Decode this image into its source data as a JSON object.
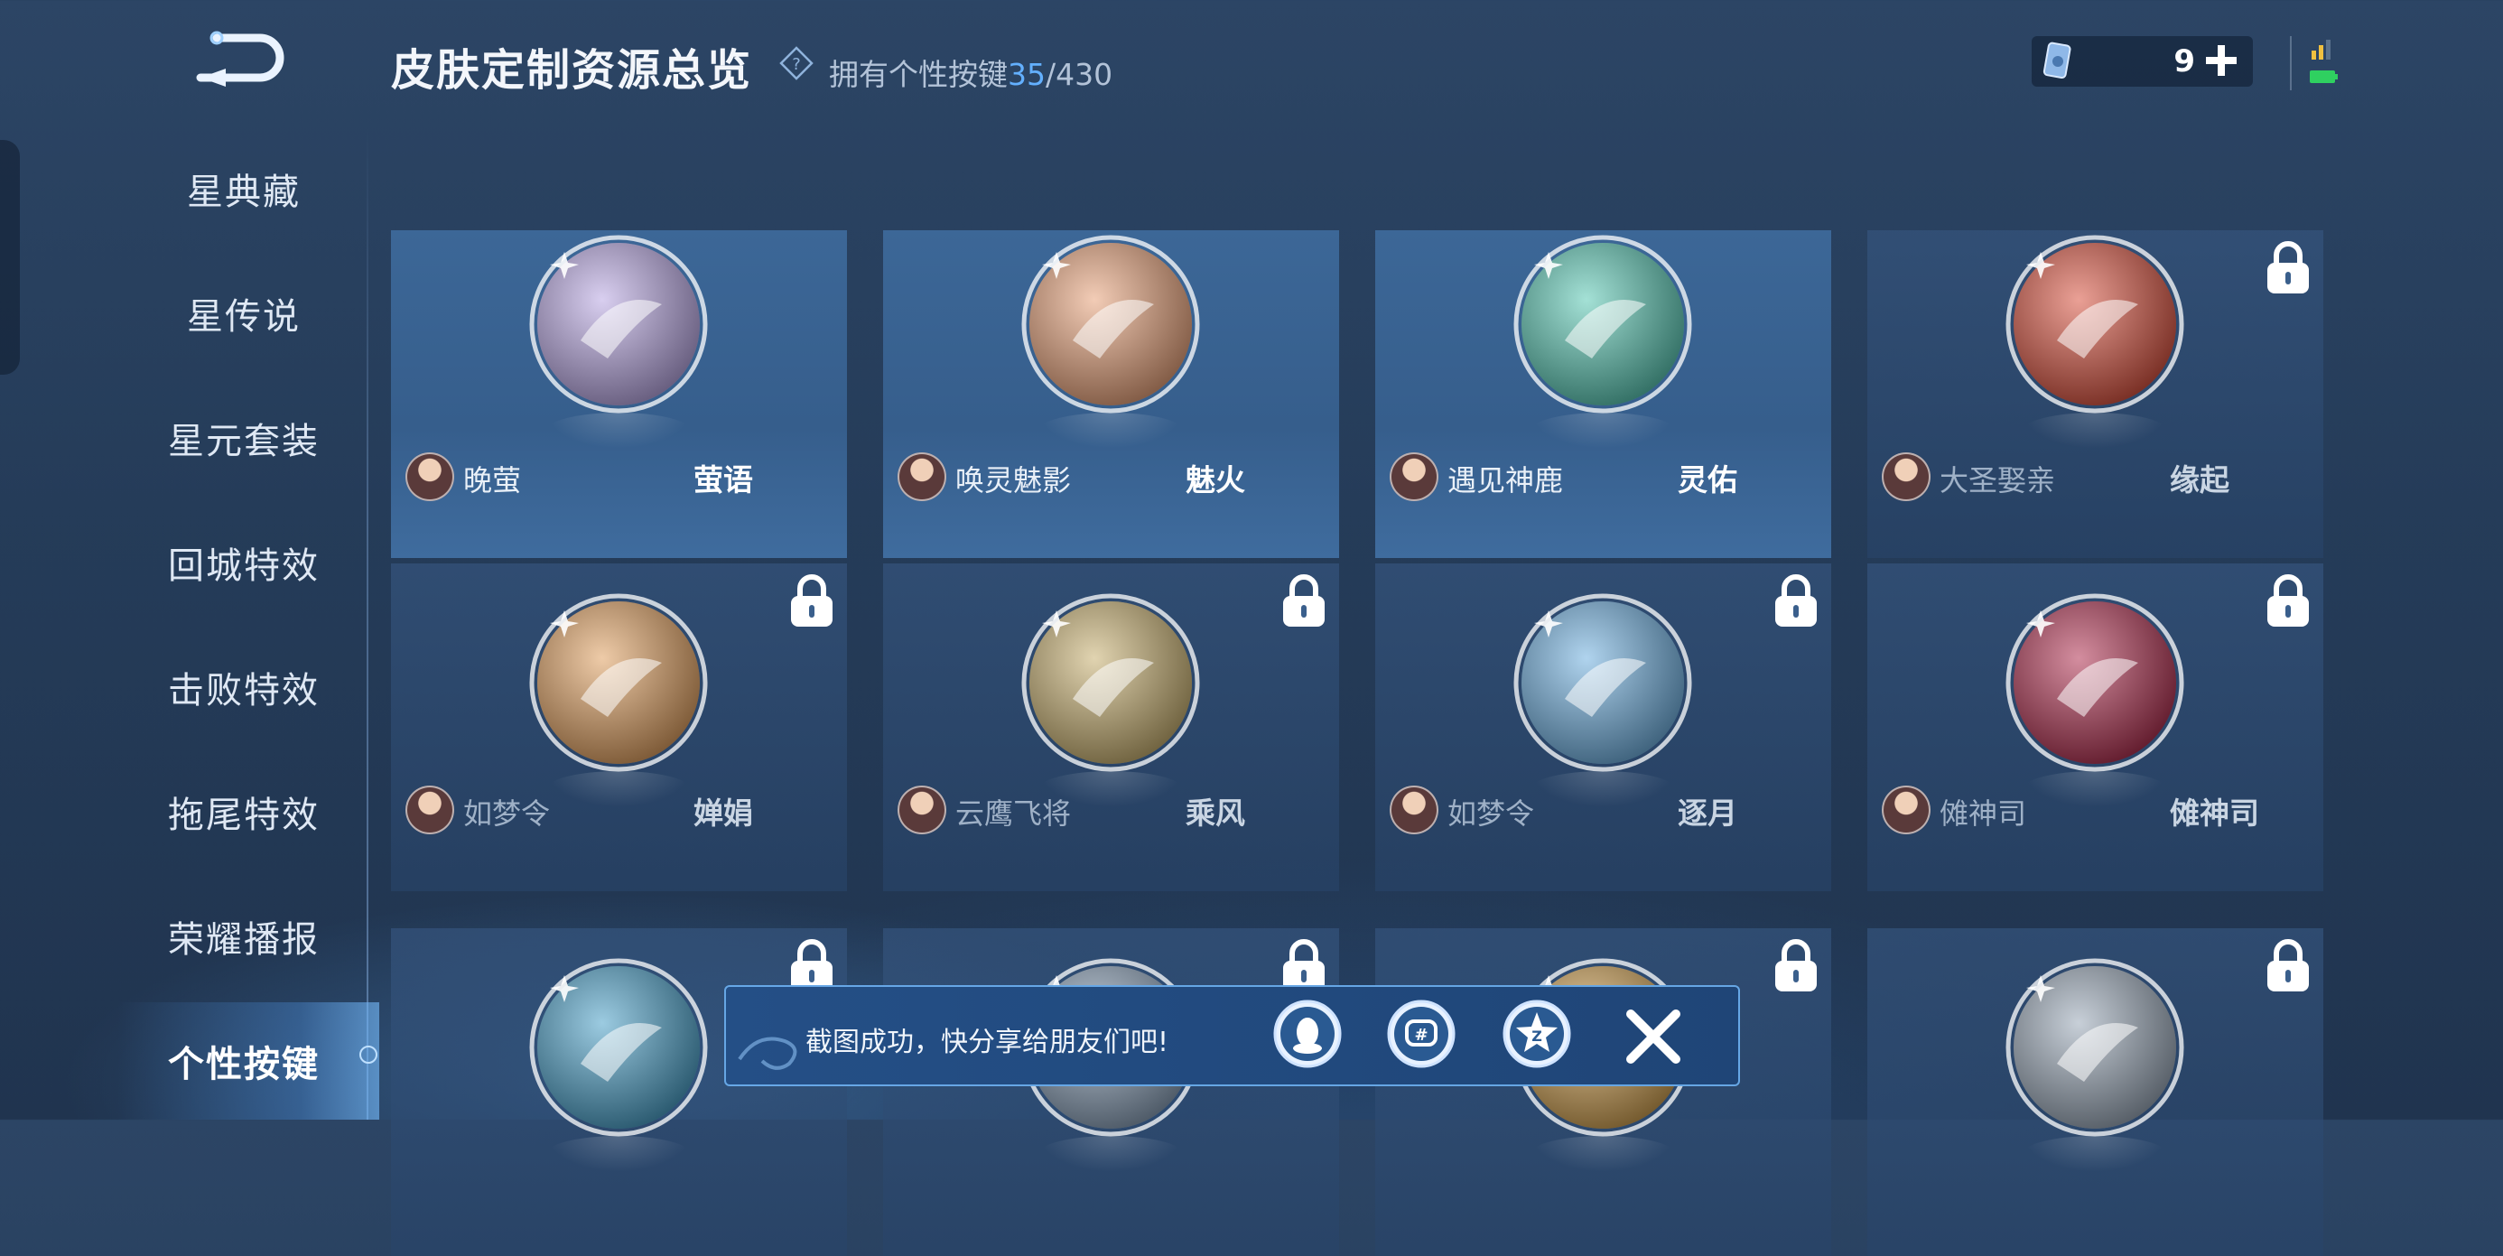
{
  "header": {
    "title": "皮肤定制资源总览",
    "owned_label": "拥有个性按键",
    "owned_count": "35",
    "owned_total": "/430"
  },
  "currency": {
    "amount": "9"
  },
  "sidebar": {
    "items": [
      {
        "label": "星典藏"
      },
      {
        "label": "星传说"
      },
      {
        "label": "星元套装"
      },
      {
        "label": "回城特效"
      },
      {
        "label": "击败特效"
      },
      {
        "label": "拖尾特效"
      },
      {
        "label": "荣耀播报"
      },
      {
        "label": "个性按键"
      }
    ],
    "active_item": "个性按键"
  },
  "cards": [
    {
      "skin": "晚萤",
      "effect": "萤语",
      "locked": false,
      "emblem_color": "#b9a7e3"
    },
    {
      "skin": "唤灵魅影",
      "effect": "魅火",
      "locked": false,
      "emblem_color": "#e8a27a"
    },
    {
      "skin": "遇见神鹿",
      "effect": "灵佑",
      "locked": false,
      "emblem_color": "#59c8b4"
    },
    {
      "skin": "大圣娶亲",
      "effect": "缘起",
      "locked": true,
      "emblem_color": "#d9523f"
    },
    {
      "skin": "如梦令",
      "effect": "婵娟",
      "locked": true,
      "emblem_color": "#e0a060"
    },
    {
      "skin": "云鹰飞将",
      "effect": "乘风",
      "locked": true,
      "emblem_color": "#c8b070"
    },
    {
      "skin": "如梦令",
      "effect": "逐月",
      "locked": true,
      "emblem_color": "#6fb0e0"
    },
    {
      "skin": "傩神司",
      "effect": "傩神司",
      "locked": true,
      "emblem_color": "#b03050"
    },
    {
      "skin": "",
      "effect": "",
      "locked": true,
      "emblem_color": "#4aa0c8"
    },
    {
      "skin": "",
      "effect": "",
      "locked": true,
      "emblem_color": "#8aa0b8"
    },
    {
      "skin": "",
      "effect": "",
      "locked": true,
      "emblem_color": "#d0a050"
    },
    {
      "skin": "",
      "effect": "",
      "locked": true,
      "emblem_color": "#9aa8b8"
    }
  ],
  "toast": {
    "message": "截图成功，快分享给朋友们吧!"
  },
  "colors": {
    "accent": "#63b0ff",
    "background": "#253c59",
    "owned_card": "#3c6797"
  }
}
